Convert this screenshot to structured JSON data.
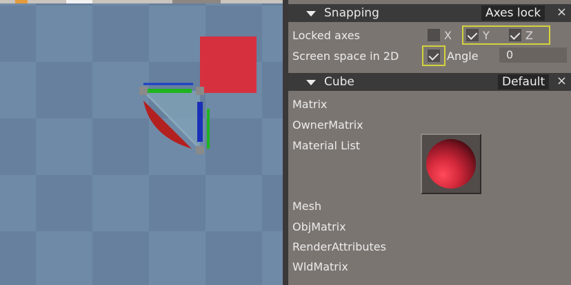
{
  "snapping": {
    "header": "Snapping",
    "mode": "Axes lock",
    "close": "×",
    "locked_axes_label": "Locked axes",
    "axes": [
      {
        "name": "X",
        "checked": false
      },
      {
        "name": "Y",
        "checked": true
      },
      {
        "name": "Z",
        "checked": true
      }
    ],
    "screen_space_label": "Screen space in 2D",
    "screen_space_checked": true,
    "angle_label": "Angle",
    "angle_value": "0"
  },
  "cube": {
    "header": "Cube",
    "mode": "Default",
    "close": "×",
    "properties": [
      "Matrix",
      "OwnerMatrix",
      "Material List",
      "Mesh",
      "ObjMatrix",
      "RenderAttributes",
      "WldMatrix"
    ]
  },
  "viewport": {
    "object_color": "#d6303f",
    "checker_colors": [
      "#66809d",
      "#6f8aa6"
    ],
    "gizmo_colors": {
      "x": "#1a3cc8",
      "y": "#1fb41f",
      "z": "#1a2fb8",
      "arc": "#b32020"
    }
  }
}
